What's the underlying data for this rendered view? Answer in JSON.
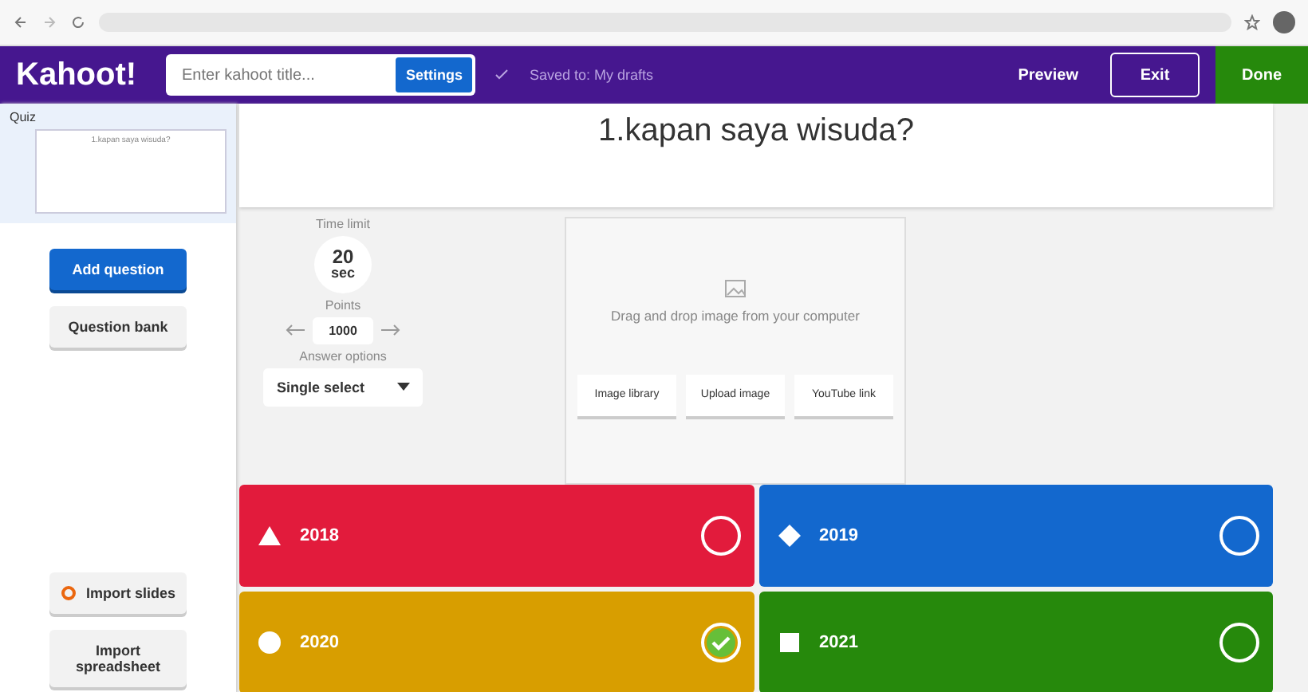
{
  "header": {
    "logo": "Kahoot!",
    "title_placeholder": "Enter kahoot title...",
    "settings": "Settings",
    "saved": "Saved to: My drafts",
    "preview": "Preview",
    "exit": "Exit",
    "done": "Done"
  },
  "sidebar": {
    "quiz_label": "Quiz",
    "slide_title": "1.kapan saya wisuda?",
    "add_question": "Add question",
    "question_bank": "Question bank",
    "import_slides": "Import slides",
    "import_spreadsheet": "Import spreadsheet"
  },
  "question": "1.kapan saya wisuda?",
  "settings": {
    "time_label": "Time limit",
    "time_value": "20",
    "time_unit": "sec",
    "points_label": "Points",
    "points_value": "1000",
    "answer_label": "Answer options",
    "answer_value": "Single select"
  },
  "media": {
    "hint": "Drag and drop image from your computer",
    "buttons": [
      "Image library",
      "Upload image",
      "YouTube link"
    ]
  },
  "answers": [
    {
      "kind": "triangle",
      "text": "2018",
      "color": "#e21b3c",
      "correct": false
    },
    {
      "kind": "diamond",
      "text": "2019",
      "color": "#1368ce",
      "correct": false
    },
    {
      "kind": "circle",
      "text": "2020",
      "color": "#d89e00",
      "correct": true
    },
    {
      "kind": "square",
      "text": "2021",
      "color": "#26890c",
      "correct": false
    }
  ]
}
